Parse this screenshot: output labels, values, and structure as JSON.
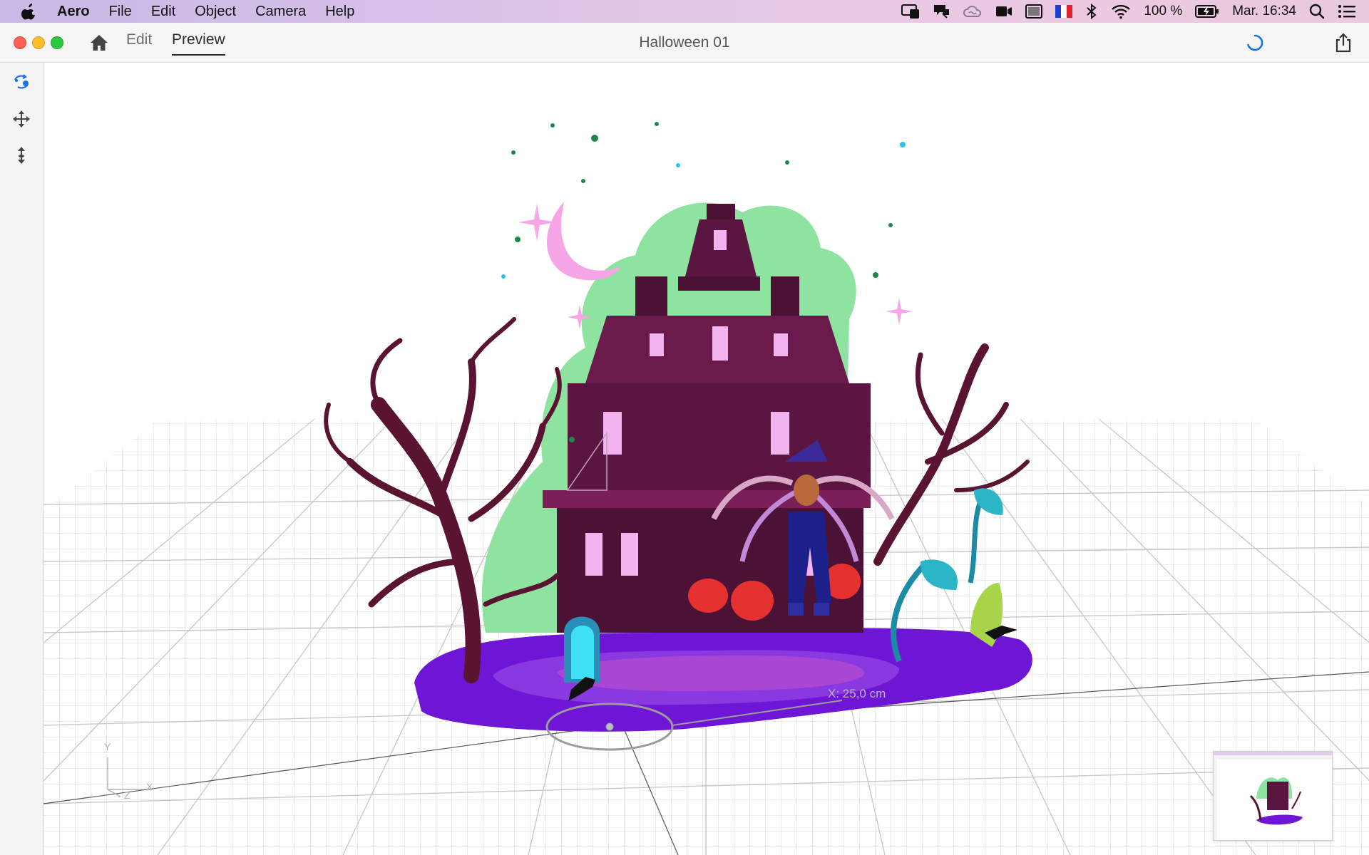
{
  "menubar": {
    "app": "Aero",
    "items": [
      "File",
      "Edit",
      "Object",
      "Camera",
      "Help"
    ],
    "battery": "100 %",
    "clock": "Mar. 16:34",
    "icons": [
      "apple-icon",
      "display-icon",
      "creative-cloud-sync-icon",
      "creative-cloud-icon",
      "facetime-camera-icon",
      "window-icon",
      "flag-france-icon",
      "bluetooth-icon",
      "wifi-icon",
      "battery-icon",
      "spotlight-search-icon",
      "notification-center-icon"
    ]
  },
  "window": {
    "title": "Halloween 01",
    "tabs": [
      "Edit",
      "Preview"
    ],
    "active_tab": "Preview"
  },
  "toolbar": {
    "tools": [
      "orbit-icon",
      "move-icon",
      "vertical-move-icon"
    ],
    "active_tool": "orbit-icon"
  },
  "viewport": {
    "measurement": "X: 25,0 cm",
    "axes": {
      "y": "Y",
      "x": "X",
      "z": "Z"
    }
  },
  "colors": {
    "accent": "#1473e6",
    "base_purple": "#6f16d6",
    "house": "#5a1640",
    "bush": "#8ee3a0",
    "moon": "#f6a6e6"
  }
}
